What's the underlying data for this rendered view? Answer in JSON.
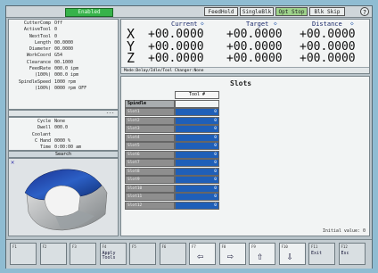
{
  "topbar": {
    "status_label": "Enabled",
    "buttons": [
      "FeedHold",
      "SingleBlk",
      "Opt Stop",
      "Blk Skip"
    ]
  },
  "info": {
    "rows": [
      {
        "label": "CutterComp",
        "value": "Off"
      },
      {
        "label": "ActiveTool",
        "value": "0"
      },
      {
        "label": "NextTool",
        "value": "0"
      },
      {
        "label": "Length",
        "value": "00.0000"
      },
      {
        "label": "Diameter",
        "value": "00.0000"
      },
      {
        "label": "WorkCoord",
        "value": "G54"
      },
      {
        "label": "Clearance",
        "value": "00.1000"
      },
      {
        "label": "FeedRate",
        "value": "000.0 ipm"
      },
      {
        "label": "(100%)",
        "value": "000.0 ipm"
      },
      {
        "label": "SpindleSpeed",
        "value": "1000 rpm"
      },
      {
        "label": "(100%)",
        "value": "0000 rpm OFF"
      }
    ],
    "small_box": "---",
    "cycle_rows": [
      {
        "label": "Cycle",
        "value": "None"
      },
      {
        "label": "Dwell",
        "value": "000.0"
      },
      {
        "label": "Coolant",
        "value": ""
      },
      {
        "label": "C Hand",
        "value": "0000  %"
      },
      {
        "label": "Time",
        "value": "0:00:00 am"
      }
    ],
    "section_label": "Search"
  },
  "dro": {
    "headers": [
      "Current",
      "Target",
      "Distance"
    ],
    "axes": [
      {
        "axis": "X",
        "current": "+00.0000",
        "target": "+00.0000",
        "distance": "+00.0000"
      },
      {
        "axis": "Y",
        "current": "+00.0000",
        "target": "+00.0000",
        "distance": "+00.0000"
      },
      {
        "axis": "Z",
        "current": "+00.0000",
        "target": "+00.0000",
        "distance": "+00.0000"
      }
    ],
    "status_line": "Mode:Delay/Idle/Tool Changer:None"
  },
  "slots": {
    "title": "Slots",
    "tool_header": "Tool #",
    "first_row_label": "Spindle",
    "rows": [
      {
        "name": "Slot1",
        "tool": "0"
      },
      {
        "name": "Slot2",
        "tool": "0"
      },
      {
        "name": "Slot3",
        "tool": "0"
      },
      {
        "name": "Slot4",
        "tool": "0"
      },
      {
        "name": "Slot5",
        "tool": "0"
      },
      {
        "name": "Slot6",
        "tool": "0"
      },
      {
        "name": "Slot7",
        "tool": "0"
      },
      {
        "name": "Slot8",
        "tool": "0"
      },
      {
        "name": "Slot9",
        "tool": "0"
      },
      {
        "name": "Slot10",
        "tool": "0"
      },
      {
        "name": "Slot11",
        "tool": "0"
      },
      {
        "name": "Slot12",
        "tool": "0"
      }
    ],
    "initial_value": "Initial value: 0"
  },
  "fkeys": [
    {
      "n": "F1",
      "text": ""
    },
    {
      "n": "F2",
      "text": ""
    },
    {
      "n": "F3",
      "text": ""
    },
    {
      "n": "F4",
      "text": "Apply\nTools"
    },
    {
      "n": "F5",
      "text": ""
    },
    {
      "n": "F6",
      "text": ""
    },
    {
      "n": "F7",
      "text": "⇦"
    },
    {
      "n": "F8",
      "text": "⇨"
    },
    {
      "n": "F9",
      "text": "⇧"
    },
    {
      "n": "F10",
      "text": "⇩"
    },
    {
      "n": "F11",
      "text": "Exit"
    },
    {
      "n": "F12",
      "text": "Esc"
    }
  ],
  "colors": {
    "enabled_green": "#37b24a",
    "slot_blue": "#1f5fb8",
    "slot_name_gray": "#8e8e8e",
    "panel_white": "#f2f4f4"
  }
}
